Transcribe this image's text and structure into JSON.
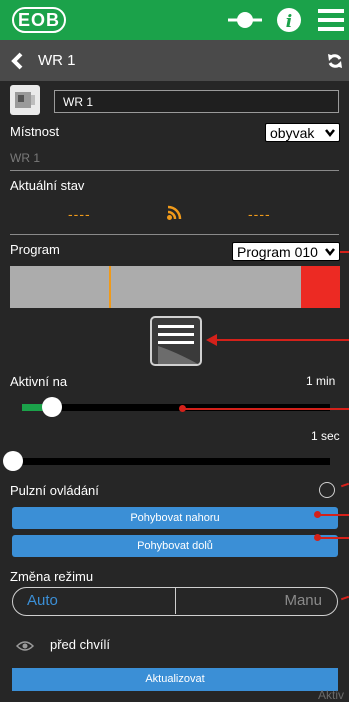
{
  "app": {
    "logo": "EOB"
  },
  "header": {
    "title": "WR 1"
  },
  "device": {
    "name_value": "WR 1"
  },
  "room": {
    "label": "Místnost",
    "selected": "obyvak",
    "subtitle": "WR 1"
  },
  "state": {
    "label": "Aktuální stav",
    "left_value": "----",
    "right_value": "----"
  },
  "program": {
    "label": "Program",
    "selected": "Program 010"
  },
  "active": {
    "label": "Aktivní na",
    "value": "1 min",
    "sec_value": "1 sec"
  },
  "pulse": {
    "label": "Pulzní ovládání"
  },
  "buttons": {
    "up": "Pohybovat nahoru",
    "down": "Pohybovat dolů"
  },
  "mode": {
    "label": "Změna režimu",
    "auto": "Auto",
    "manual": "Manu"
  },
  "footer": {
    "timestamp": "před chvílí",
    "update": "Aktualizovat",
    "watermark": "Aktiv"
  },
  "colors": {
    "green": "#1ba24a",
    "orange": "#f09a1a",
    "red": "#ec2a23",
    "blue": "#3b8fd6"
  }
}
